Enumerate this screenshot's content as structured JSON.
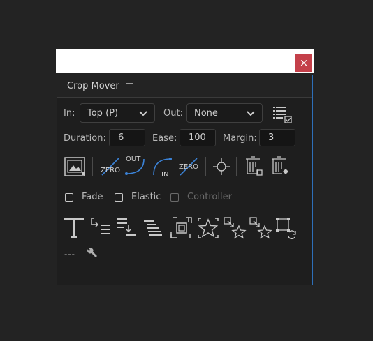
{
  "window": {
    "close_glyph": "×"
  },
  "panel": {
    "title": "Crop Mover",
    "menu_icon": "hamburger-menu-icon"
  },
  "row1": {
    "in_label": "In:",
    "in_value": "Top (P)",
    "out_label": "Out:",
    "out_value": "None",
    "list_icon": "checklist-icon"
  },
  "row2": {
    "duration_label": "Duration:",
    "duration_value": "6",
    "ease_label": "Ease:",
    "ease_value": "100",
    "margin_label": "Margin:",
    "margin_value": "3"
  },
  "row3": {
    "zero_out_text": "ZERO",
    "out_text": "OUT",
    "in_text": "IN",
    "zero_in_text": "ZERO"
  },
  "checks": {
    "fade": "Fade",
    "elastic": "Elastic",
    "controller": "Controller"
  },
  "row5": {
    "dashes": "---"
  },
  "colors": {
    "accent": "#2e6fb8",
    "icon": "#c8c8c8",
    "curve": "#3b82d6",
    "close": "#c4404a"
  }
}
